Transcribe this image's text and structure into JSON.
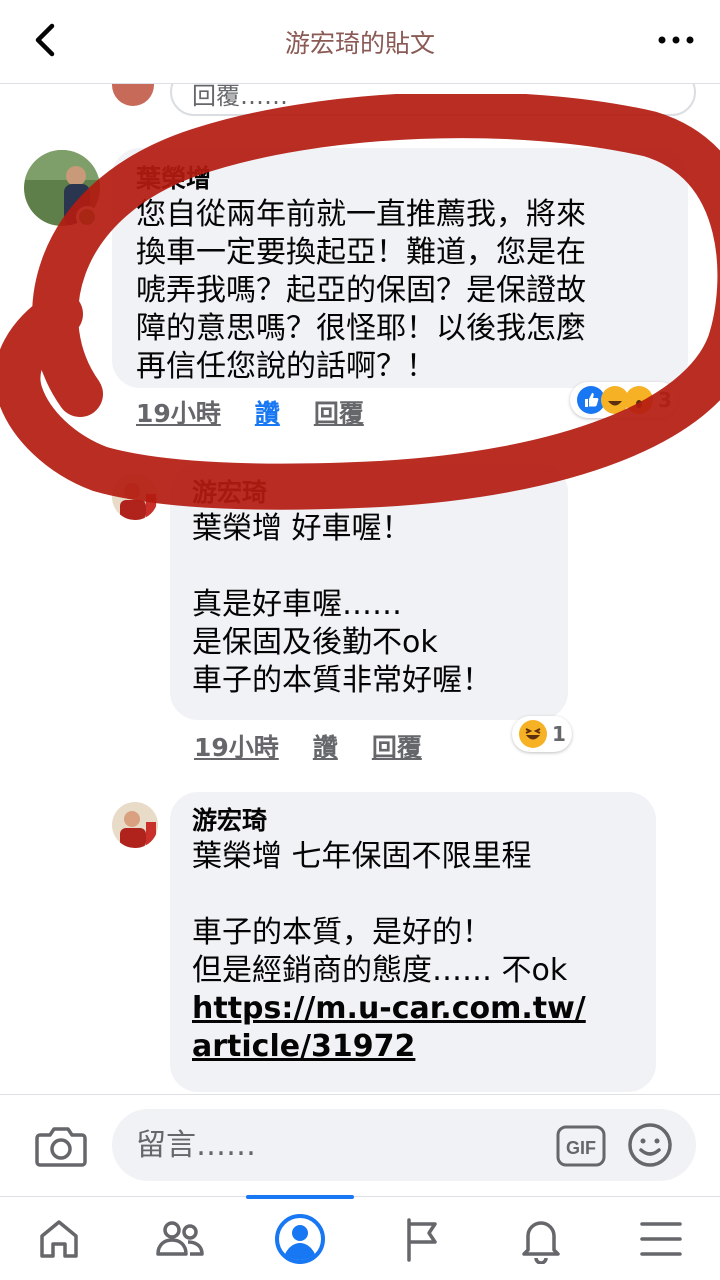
{
  "header": {
    "title": "游宏琦的貼文",
    "back_icon": "chevron-left-icon",
    "more_icon": "more-horizontal-icon"
  },
  "reply_stub": {
    "placeholder": "回覆……"
  },
  "comments": [
    {
      "author": "葉榮增",
      "text": "您自從兩年前就一直推薦我，將來\n換車一定要換起亞！難道，您是在\n唬弄我嗎？起亞的保固？是保證故\n障的意思嗎？很怪耶！以後我怎麼\n再信任您說的話啊？！",
      "time": "19小時",
      "like_label": "讚",
      "reply_label": "回覆",
      "reactions": [
        "like",
        "haha",
        "wow"
      ],
      "reaction_count": "3"
    },
    {
      "author": "游宏琦",
      "text": "葉榮增 好車喔！\n\n真是好車喔……\n是保固及後勤不ok\n車子的本質非常好喔！",
      "time": "19小時",
      "like_label": "讚",
      "reply_label": "回覆",
      "reactions": [
        "haha"
      ],
      "reaction_count": "1"
    },
    {
      "author": "游宏琦",
      "text": "葉榮增 七年保固不限里程\n\n車子的本質，是好的！\n但是經銷商的態度…… 不ok",
      "link": "https://m.u-car.com.tw/\narticle/31972"
    }
  ],
  "composer": {
    "placeholder": "留言……",
    "camera_icon": "camera-icon",
    "gif_label": "GIF",
    "emoji_icon": "smiley-icon"
  },
  "bottom_nav": {
    "items": [
      "home-icon",
      "friends-icon",
      "profile-icon",
      "pages-flag-icon",
      "notifications-bell-icon",
      "menu-icon"
    ],
    "active_index": 2
  },
  "colors": {
    "accent": "#1877f2",
    "bubble": "#f0f2f5",
    "annotation_red": "#b31b10",
    "online": "#31a24c"
  }
}
